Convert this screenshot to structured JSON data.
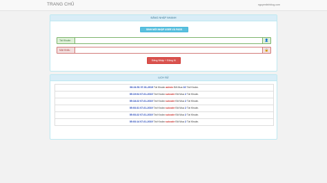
{
  "navbar": {
    "brand": "TRANG CHỦ",
    "link": "nguyenlinhblog.com"
  },
  "login_panel": {
    "title": "ĐĂNG NHẬP NHANH",
    "create_button": "SINH MỚI NHẬP USER VÀ PASS",
    "username_label": "Tài Khoản",
    "username_value": "",
    "password_label": "Mật Khẩu",
    "password_value": "",
    "submit_button": "Đăng Nhập + Đăng Kí"
  },
  "history_panel": {
    "title": "LỊCH SỬ",
    "entries": [
      {
        "time": "06:24:51 07-01-2019",
        "prefix": " Tài Khoản ",
        "user": "admin",
        "middle": " Đã Mua ",
        "count": "16",
        "suffix": " Tài Khoản."
      },
      {
        "time": "05:19:04 07-01-2019",
        "prefix": " Tài Khoản ",
        "user": "suicode",
        "middle": " Đã Mua ",
        "count": "2",
        "suffix": " Tài Khoản."
      },
      {
        "time": "05:18:22 07-01-2019",
        "prefix": " Tài Khoản ",
        "user": "suicode",
        "middle": " Đã Mua ",
        "count": "2",
        "suffix": " Tài Khoản."
      },
      {
        "time": "05:03:31 07-01-2019",
        "prefix": " Tài Khoản ",
        "user": "suicode",
        "middle": " Đã Mua ",
        "count": "2",
        "suffix": " Tài Khoản."
      },
      {
        "time": "05:03:22 07-01-2019",
        "prefix": " Tài Khoản ",
        "user": "suicode",
        "middle": " Đã Mua ",
        "count": "2",
        "suffix": " Tài Khoản."
      },
      {
        "time": "05:03:14 07-01-2019",
        "prefix": " Tài Khoản ",
        "user": "suicode",
        "middle": " Đã Mua ",
        "count": "2",
        "suffix": " Tài Khoản."
      }
    ]
  },
  "icons": {
    "user": "user-icon",
    "lock": "lock-icon"
  },
  "colors": {
    "heading_bg": "#d9edf7",
    "info_button": "#5bc0de",
    "danger_button": "#d9534f",
    "success_border": "#7bb36a",
    "error_border": "#d27a78"
  }
}
